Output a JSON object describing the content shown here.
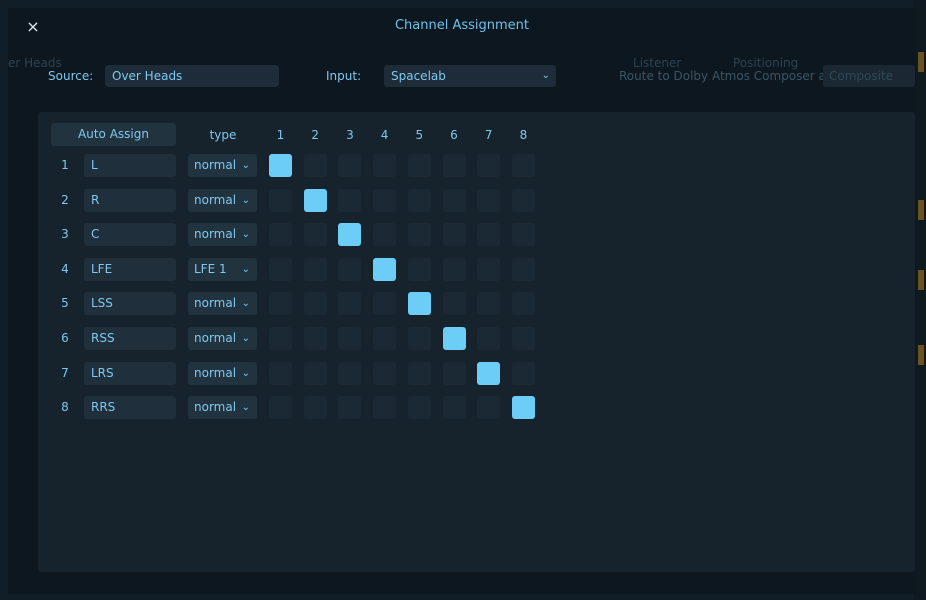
{
  "dialog": {
    "title": "Channel Assignment",
    "close_glyph": "×",
    "background_text": {
      "left_top": "er Heads",
      "ghost_source": "Source",
      "ghost_listener": "Listener",
      "ghost_positioning": "Positioning",
      "ghost_dots": "..."
    }
  },
  "source": {
    "label": "Source:",
    "value": "Over Heads"
  },
  "input": {
    "label": "Input:",
    "value": "Spacelab"
  },
  "route": {
    "label": "Route to Dolby Atmos Composer as:",
    "value": "Composite"
  },
  "matrix": {
    "auto_assign_label": "Auto Assign",
    "type_header": "type",
    "column_headers": [
      "1",
      "2",
      "3",
      "4",
      "5",
      "6",
      "7",
      "8"
    ],
    "rows": [
      {
        "num": "1",
        "name": "L",
        "type": "normal",
        "assigned": 1
      },
      {
        "num": "2",
        "name": "R",
        "type": "normal",
        "assigned": 2
      },
      {
        "num": "3",
        "name": "C",
        "type": "normal",
        "assigned": 3
      },
      {
        "num": "4",
        "name": "LFE",
        "type": "LFE 1",
        "assigned": 4
      },
      {
        "num": "5",
        "name": "LSS",
        "type": "normal",
        "assigned": 5
      },
      {
        "num": "6",
        "name": "RSS",
        "type": "normal",
        "assigned": 6
      },
      {
        "num": "7",
        "name": "LRS",
        "type": "normal",
        "assigned": 7
      },
      {
        "num": "8",
        "name": "RRS",
        "type": "normal",
        "assigned": 8
      }
    ]
  },
  "colors": {
    "accent": "#6ccdf7",
    "cell_off": "#1b2934",
    "text": "#7fc8ee",
    "dialog_bg": "#0c171f"
  }
}
